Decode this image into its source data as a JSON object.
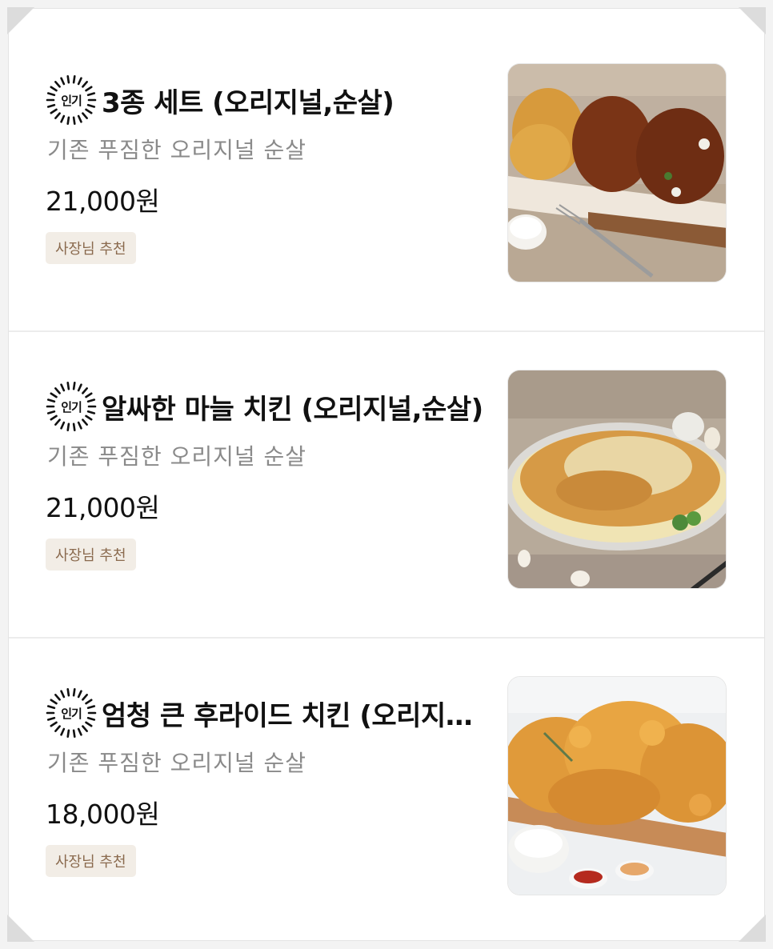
{
  "menu": {
    "items": [
      {
        "badge": "인기",
        "name": "3종 세트 (오리지널,순살)",
        "description": "기존 푸짐한 오리지널 순살",
        "price": "21,000원",
        "tag": "사장님 추천",
        "image_icon": "chicken-three-flavors-photo"
      },
      {
        "badge": "인기",
        "name": "알싸한 마늘 치킨 (오리지널,순살)",
        "description": "기존 푸짐한 오리지널 순살",
        "price": "21,000원",
        "tag": "사장님 추천",
        "image_icon": "garlic-chicken-photo"
      },
      {
        "badge": "인기",
        "name": "엄청 큰 후라이드 치킨 (오리지널,순살)",
        "description": "기존 푸짐한 오리지널 순살",
        "price": "18,000원",
        "tag": "사장님 추천",
        "image_icon": "fried-chicken-photo"
      }
    ]
  },
  "colors": {
    "title": "#111111",
    "description": "#8a8a8a",
    "tag_bg": "#f2ede6",
    "tag_text": "#8a6a4e",
    "divider": "#ececec"
  }
}
